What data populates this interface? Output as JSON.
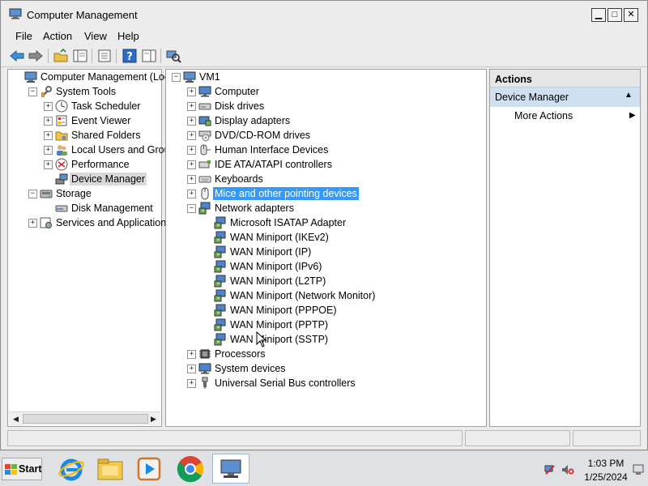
{
  "window": {
    "title": "Computer Management"
  },
  "menu": [
    "File",
    "Action",
    "View",
    "Help"
  ],
  "left_tree": [
    {
      "label": "Computer Management (Local",
      "exp": "",
      "level": 0,
      "icon": "computer-management-icon"
    },
    {
      "label": "System Tools",
      "exp": "−",
      "level": 1,
      "icon": "system-tools-icon"
    },
    {
      "label": "Task Scheduler",
      "exp": "+",
      "level": 2,
      "icon": "clock-icon"
    },
    {
      "label": "Event Viewer",
      "exp": "+",
      "level": 2,
      "icon": "event-viewer-icon"
    },
    {
      "label": "Shared Folders",
      "exp": "+",
      "level": 2,
      "icon": "folder-icon"
    },
    {
      "label": "Local Users and Groups",
      "exp": "+",
      "level": 2,
      "icon": "users-icon"
    },
    {
      "label": "Performance",
      "exp": "+",
      "level": 2,
      "icon": "performance-icon"
    },
    {
      "label": "Device Manager",
      "exp": "",
      "level": 2,
      "icon": "device-manager-icon",
      "selected": true
    },
    {
      "label": "Storage",
      "exp": "−",
      "level": 1,
      "icon": "storage-icon"
    },
    {
      "label": "Disk Management",
      "exp": "",
      "level": 2,
      "icon": "disk-icon"
    },
    {
      "label": "Services and Applications",
      "exp": "+",
      "level": 1,
      "icon": "services-icon"
    }
  ],
  "device_tree": [
    {
      "label": "VM1",
      "exp": "−",
      "level": 0,
      "icon": "computer-icon"
    },
    {
      "label": "Computer",
      "exp": "+",
      "level": 1,
      "icon": "monitor-icon"
    },
    {
      "label": "Disk drives",
      "exp": "+",
      "level": 1,
      "icon": "disk-drive-icon"
    },
    {
      "label": "Display adapters",
      "exp": "+",
      "level": 1,
      "icon": "display-adapter-icon"
    },
    {
      "label": "DVD/CD-ROM drives",
      "exp": "+",
      "level": 1,
      "icon": "dvd-icon"
    },
    {
      "label": "Human Interface Devices",
      "exp": "+",
      "level": 1,
      "icon": "hid-icon"
    },
    {
      "label": "IDE ATA/ATAPI controllers",
      "exp": "+",
      "level": 1,
      "icon": "ide-controller-icon"
    },
    {
      "label": "Keyboards",
      "exp": "+",
      "level": 1,
      "icon": "keyboard-icon"
    },
    {
      "label": "Mice and other pointing devices",
      "exp": "+",
      "level": 1,
      "icon": "mouse-icon",
      "selected": true
    },
    {
      "label": "Network adapters",
      "exp": "−",
      "level": 1,
      "icon": "network-adapter-icon"
    },
    {
      "label": "Microsoft ISATAP Adapter",
      "exp": "",
      "level": 2,
      "icon": "network-adapter-icon"
    },
    {
      "label": "WAN Miniport (IKEv2)",
      "exp": "",
      "level": 2,
      "icon": "network-adapter-icon"
    },
    {
      "label": "WAN Miniport (IP)",
      "exp": "",
      "level": 2,
      "icon": "network-adapter-icon"
    },
    {
      "label": "WAN Miniport (IPv6)",
      "exp": "",
      "level": 2,
      "icon": "network-adapter-icon"
    },
    {
      "label": "WAN Miniport (L2TP)",
      "exp": "",
      "level": 2,
      "icon": "network-adapter-icon"
    },
    {
      "label": "WAN Miniport (Network Monitor)",
      "exp": "",
      "level": 2,
      "icon": "network-adapter-icon"
    },
    {
      "label": "WAN Miniport (PPPOE)",
      "exp": "",
      "level": 2,
      "icon": "network-adapter-icon"
    },
    {
      "label": "WAN Miniport (PPTP)",
      "exp": "",
      "level": 2,
      "icon": "network-adapter-icon"
    },
    {
      "label": "WAN Miniport (SSTP)",
      "exp": "",
      "level": 2,
      "icon": "network-adapter-icon"
    },
    {
      "label": "Processors",
      "exp": "+",
      "level": 1,
      "icon": "processor-icon"
    },
    {
      "label": "System devices",
      "exp": "+",
      "level": 1,
      "icon": "monitor-icon"
    },
    {
      "label": "Universal Serial Bus controllers",
      "exp": "+",
      "level": 1,
      "icon": "usb-icon"
    }
  ],
  "actions": {
    "header": "Actions",
    "section": "Device Manager",
    "more": "More Actions"
  },
  "taskbar": {
    "start": "Start",
    "time": "1:03 PM",
    "date": "1/25/2024"
  },
  "colors": {
    "selection": "#3399ff",
    "actions_section": "#cfe0f0"
  }
}
